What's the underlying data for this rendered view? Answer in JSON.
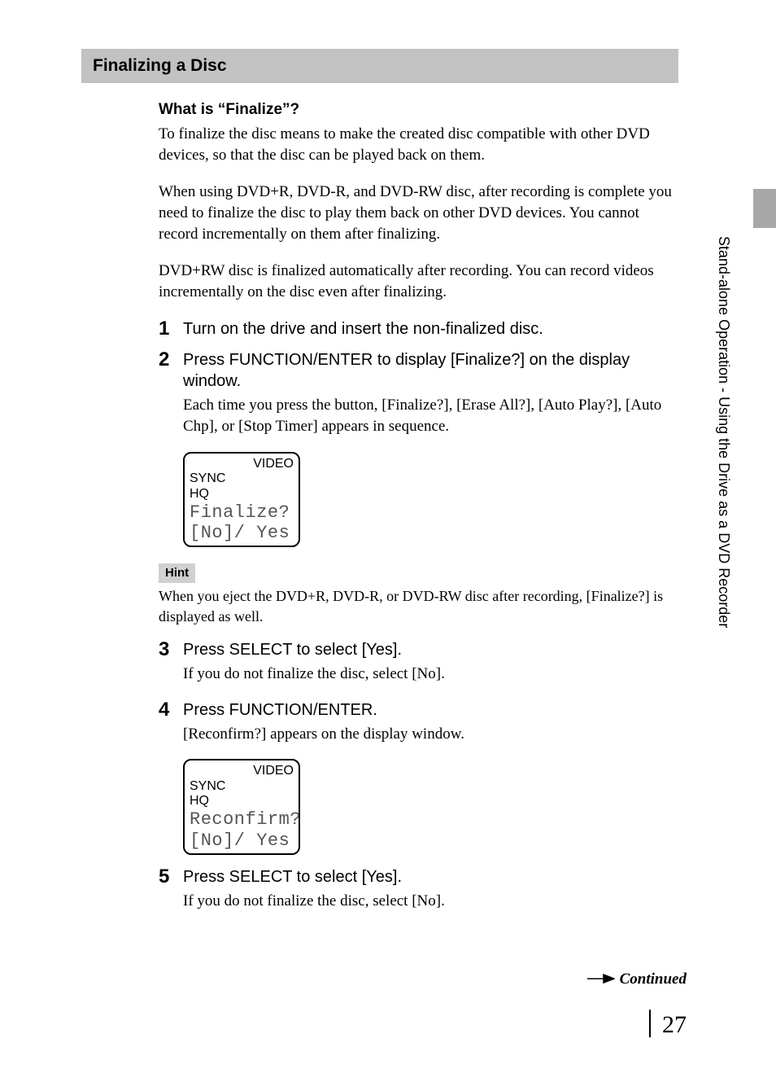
{
  "section_heading": "Finalizing a Disc",
  "vertical_label": "Stand-alone Operation - Using the Drive as a DVD Recorder",
  "whatis": {
    "heading": "What is “Finalize”?",
    "p1": "To finalize the disc means to make the created disc compatible with other DVD devices, so that the disc can be played back on them.",
    "p2": "When using DVD+R, DVD-R, and DVD-RW disc, after recording is complete you need to finalize the disc to play them back on other DVD devices. You cannot record incrementally on them after finalizing.",
    "p3": "DVD+RW disc is finalized automatically after recording. You can record videos incrementally on the disc even after finalizing."
  },
  "steps": [
    {
      "num": "1",
      "title": "Turn on the drive and insert the non-finalized disc."
    },
    {
      "num": "2",
      "title": "Press FUNCTION/ENTER to display [Finalize?] on the display window.",
      "text": "Each time you press the button, [Finalize?], [Erase All?], [Auto Play?], [Auto Chp], or [Stop Timer] appears in sequence.",
      "display": {
        "top_right": "VIDEO",
        "l1": "SYNC",
        "l2": "HQ",
        "lcd1": "Finalize?",
        "lcd2": "[No]/ Yes"
      },
      "hint_label": "Hint",
      "hint_text": "When you eject the DVD+R, DVD-R, or DVD-RW disc after recording, [Finalize?] is displayed as well."
    },
    {
      "num": "3",
      "title": "Press SELECT to select [Yes].",
      "text": "If you do not finalize the disc, select [No]."
    },
    {
      "num": "4",
      "title": "Press FUNCTION/ENTER.",
      "text": "[Reconfirm?] appears on the display window.",
      "display": {
        "top_right": "VIDEO",
        "l1": "SYNC",
        "l2": "HQ",
        "lcd1": "Reconfirm?",
        "lcd2": "[No]/ Yes"
      }
    },
    {
      "num": "5",
      "title": "Press SELECT to select [Yes].",
      "text": "If you do not finalize the disc, select [No]."
    }
  ],
  "continued": "Continued",
  "page_number": "27"
}
